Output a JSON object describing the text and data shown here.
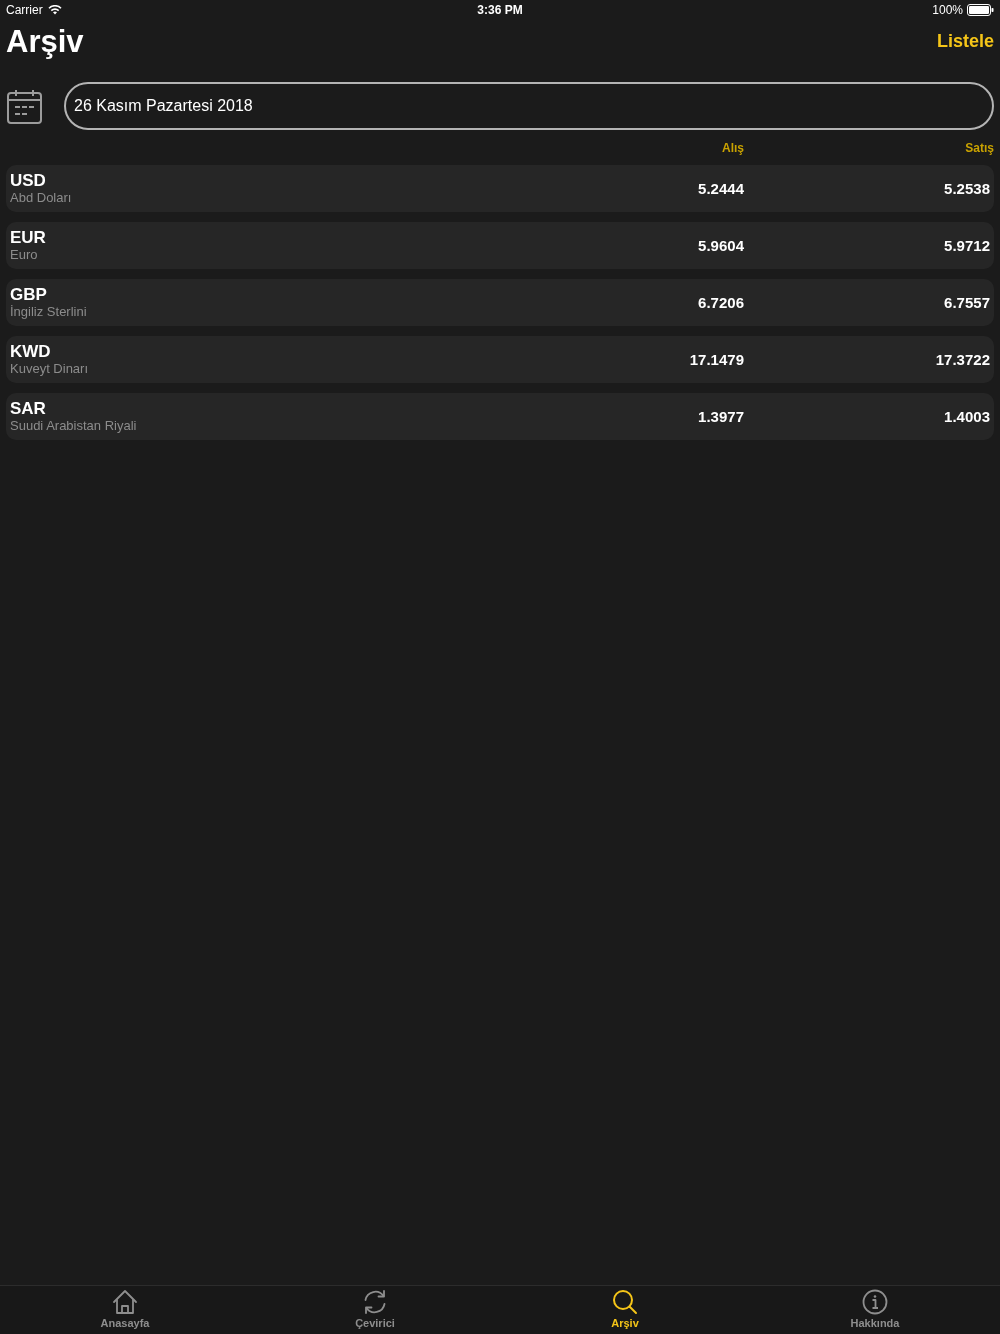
{
  "status_bar": {
    "carrier": "Carrier",
    "time": "3:36 PM",
    "battery": "100%"
  },
  "nav": {
    "title": "Arşiv",
    "action": "Listele"
  },
  "date_field": {
    "value": "26 Kasım Pazartesi 2018"
  },
  "columns": [
    "Alış",
    "Satış"
  ],
  "rates": [
    {
      "code": "USD",
      "name": "Abd Doları",
      "buy": "5.2444",
      "sell": "5.2538"
    },
    {
      "code": "EUR",
      "name": "Euro",
      "buy": "5.9604",
      "sell": "5.9712"
    },
    {
      "code": "GBP",
      "name": "İngiliz Sterlini",
      "buy": "6.7206",
      "sell": "6.7557"
    },
    {
      "code": "KWD",
      "name": "Kuveyt Dinarı",
      "buy": "17.1479",
      "sell": "17.3722"
    },
    {
      "code": "SAR",
      "name": "Suudi Arabistan Riyali",
      "buy": "1.3977",
      "sell": "1.4003"
    }
  ],
  "tab_bar": [
    {
      "label": "Anasayfa",
      "selected": false
    },
    {
      "label": "Çevirici",
      "selected": false
    },
    {
      "label": "Arşiv",
      "selected": true
    },
    {
      "label": "Hakkında",
      "selected": false
    }
  ]
}
